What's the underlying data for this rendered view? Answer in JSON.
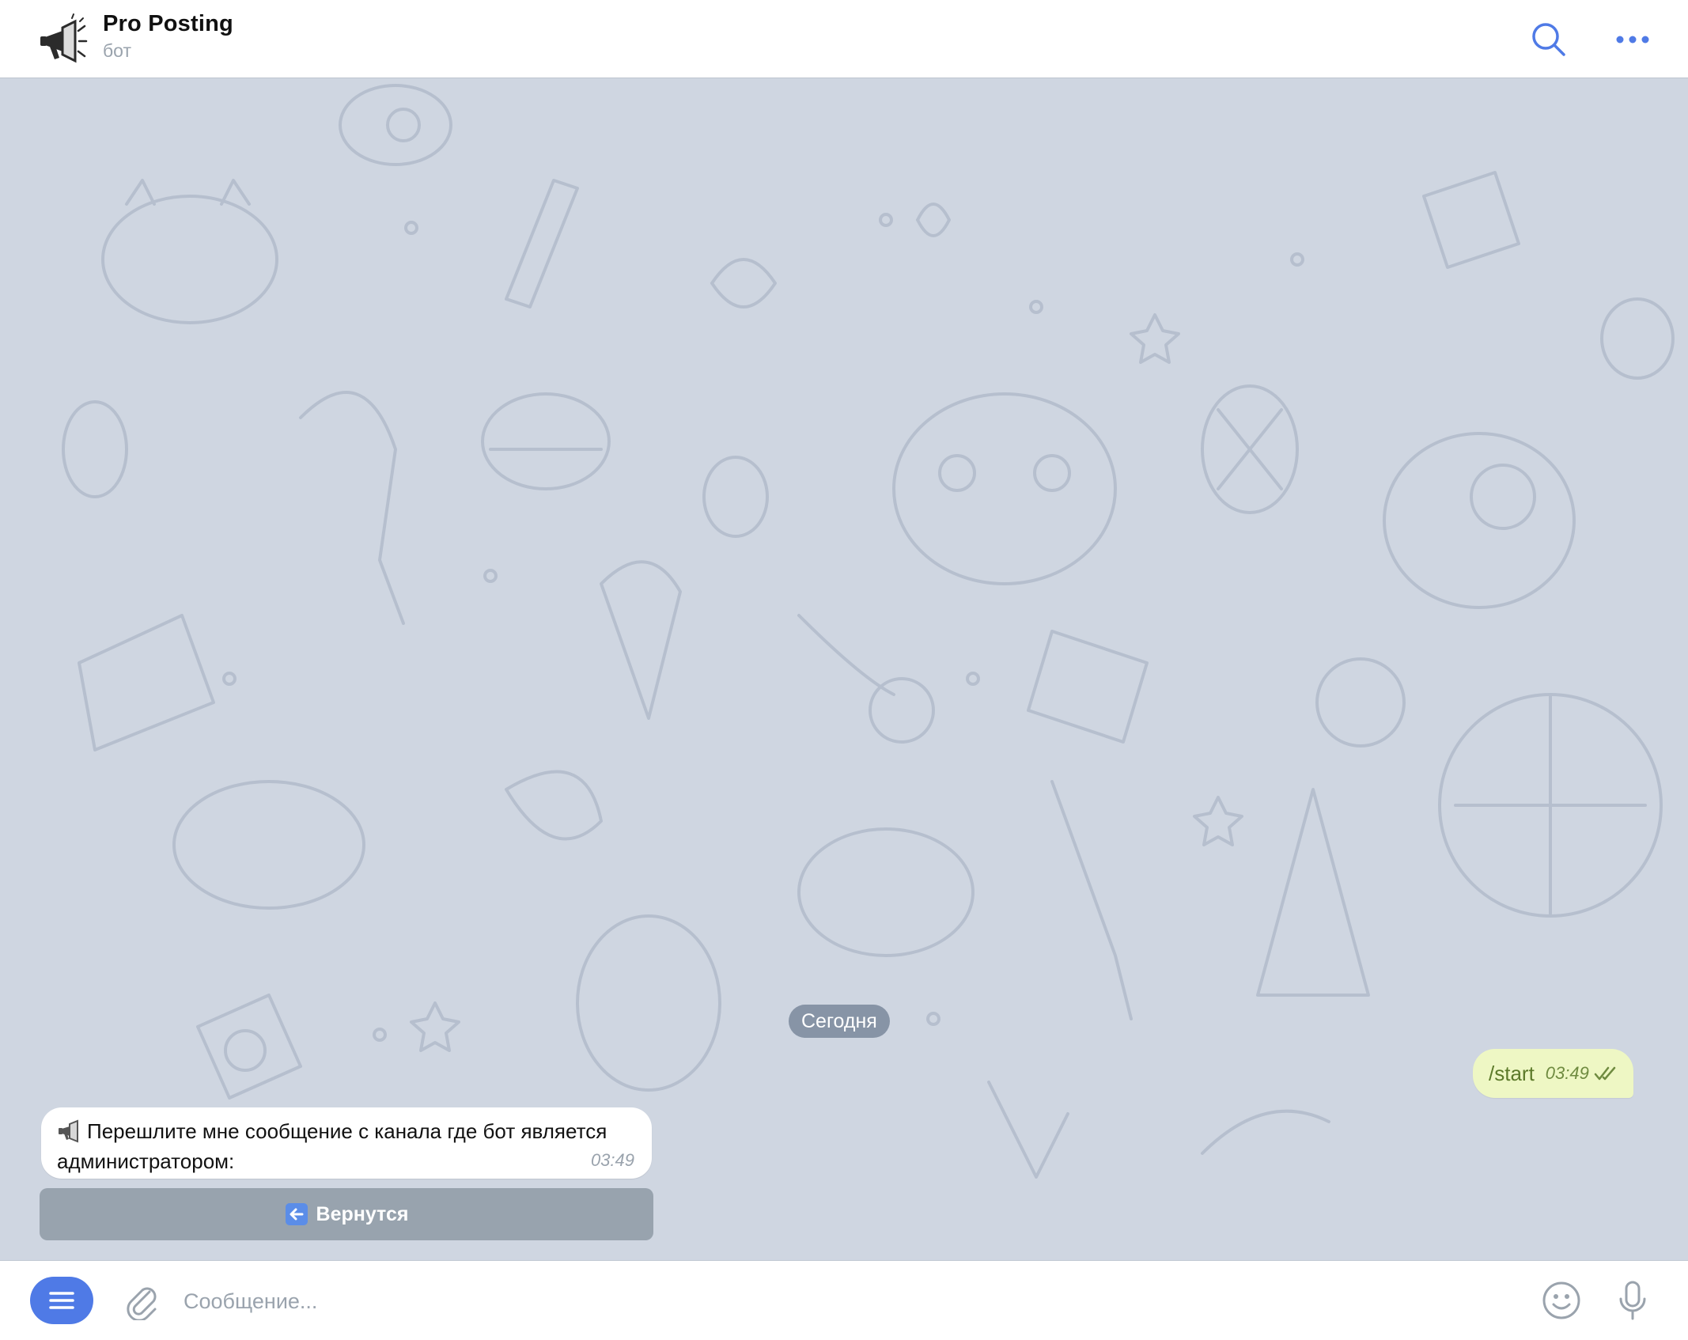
{
  "header": {
    "title": "Pro Posting",
    "subtitle": "бот",
    "avatar_icon": "megaphone-icon",
    "search_icon": "search-icon",
    "more_icon": "more-icon"
  },
  "chat": {
    "date_separator": "Сегодня",
    "messages": [
      {
        "direction": "out",
        "text": "/start",
        "time": "03:49",
        "status": "read"
      },
      {
        "direction": "in",
        "emoji_icon": "megaphone-icon",
        "text": "Перешлите мне сообщение с канала где бот является администратором:",
        "time": "03:49"
      }
    ],
    "keyboard": {
      "buttons": [
        {
          "icon": "back-arrow-icon",
          "label": "Вернутся"
        }
      ]
    }
  },
  "composer": {
    "menu_icon": "menu-icon",
    "attach_icon": "paperclip-icon",
    "placeholder": "Сообщение...",
    "value": "",
    "emoji_icon": "emoji-icon",
    "mic_icon": "microphone-icon"
  },
  "colors": {
    "accent": "#4f7ae6",
    "chat_background": "#cfd6e1",
    "outgoing_bubble": "#eef7c4",
    "incoming_bubble": "#ffffff",
    "keyboard_button": "#98a3ae",
    "date_pill": "#8794a6"
  }
}
